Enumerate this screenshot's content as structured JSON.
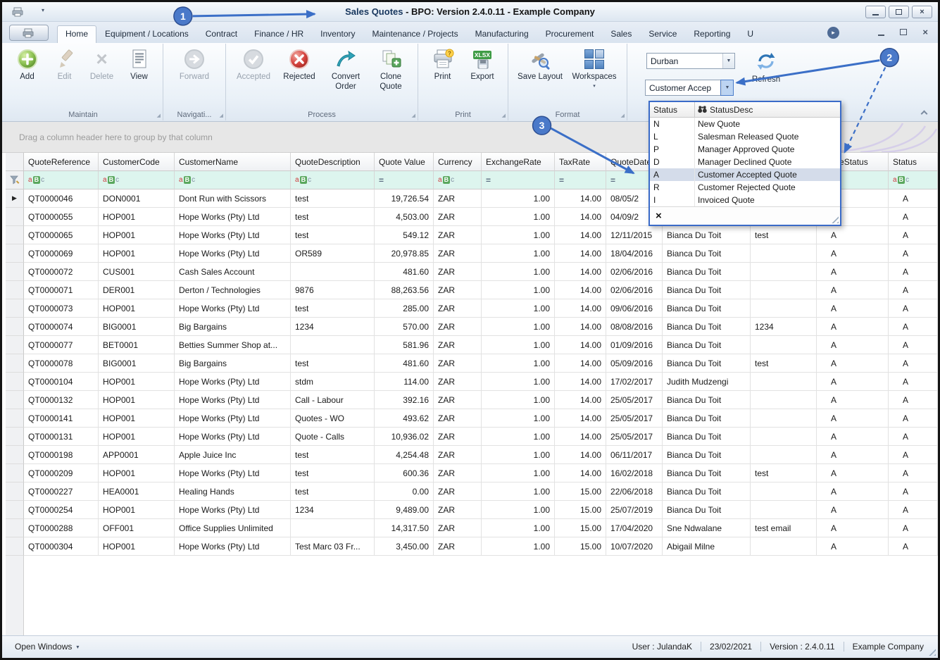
{
  "colors": {
    "accent_blue": "#3b6fc7",
    "selection_bg": "#d4dcea",
    "filter_row_bg": "#ddf5ee"
  },
  "titlebar": {
    "app_name": "Sales Quotes",
    "title_rest": " - BPO: Version 2.4.0.11 - Example Company"
  },
  "tabs": [
    {
      "label": "Home",
      "selected": true
    },
    {
      "label": "Equipment / Locations"
    },
    {
      "label": "Contract"
    },
    {
      "label": "Finance / HR"
    },
    {
      "label": "Inventory"
    },
    {
      "label": "Maintenance / Projects"
    },
    {
      "label": "Manufacturing"
    },
    {
      "label": "Procurement"
    },
    {
      "label": "Sales"
    },
    {
      "label": "Service"
    },
    {
      "label": "Reporting"
    },
    {
      "label": "U"
    }
  ],
  "ribbon": {
    "groups": [
      {
        "label": "Maintain",
        "buttons": [
          {
            "label": "Add",
            "icon": "add-icon"
          },
          {
            "label": "Edit",
            "icon": "edit-icon",
            "disabled": true
          },
          {
            "label": "Delete",
            "icon": "delete-icon",
            "disabled": true
          },
          {
            "label": "View",
            "icon": "view-icon"
          }
        ]
      },
      {
        "label": "Navigati...",
        "buttons": [
          {
            "label": "Forward",
            "icon": "forward-icon",
            "disabled": true
          }
        ]
      },
      {
        "label": "Process",
        "buttons": [
          {
            "label": "Accepted",
            "icon": "accepted-icon",
            "disabled": true
          },
          {
            "label": "Rejected",
            "icon": "rejected-icon"
          },
          {
            "label": "Convert Order",
            "icon": "convert-order-icon"
          },
          {
            "label": "Clone Quote",
            "icon": "clone-quote-icon"
          }
        ]
      },
      {
        "label": "Print",
        "buttons": [
          {
            "label": "Print",
            "icon": "print-icon"
          },
          {
            "label": "Export",
            "icon": "export-icon"
          }
        ]
      },
      {
        "label": "Format",
        "buttons": [
          {
            "label": "Save Layout",
            "icon": "save-layout-icon"
          },
          {
            "label": "Workspaces",
            "icon": "workspaces-icon",
            "dropdown": true
          }
        ]
      }
    ],
    "site_selector_value": "Durban",
    "status_filter_value": "Customer Accep",
    "refresh_label": "Refresh"
  },
  "grid": {
    "groupby_hint": "Drag a column header here to group by that column",
    "columns": [
      {
        "label": "QuoteReference",
        "filter": "abc"
      },
      {
        "label": "CustomerCode",
        "filter": "abc"
      },
      {
        "label": "CustomerName",
        "filter": "abc"
      },
      {
        "label": "QuoteDescription",
        "filter": "abc"
      },
      {
        "label": "Quote Value",
        "filter": "eq",
        "align": "right"
      },
      {
        "label": "Currency",
        "filter": "abc"
      },
      {
        "label": "ExchangeRate",
        "filter": "eq",
        "align": "right"
      },
      {
        "label": "TaxRate",
        "filter": "eq",
        "align": "right"
      },
      {
        "label": "QuoteDate",
        "filter": "eq"
      },
      {
        "label": "",
        "filter": ""
      },
      {
        "label": "",
        "filter": ""
      },
      {
        "label": "QuoteStatus",
        "filter": "abc"
      },
      {
        "label": "Status",
        "filter": "abc"
      }
    ],
    "rows": [
      [
        "QT0000046",
        "DON0001",
        "Dont Run with Scissors",
        "test",
        "19,726.54",
        "ZAR",
        "1.00",
        "14.00",
        "08/05/2",
        "",
        "",
        "",
        "A"
      ],
      [
        "QT0000055",
        "HOP001",
        "Hope Works (Pty) Ltd",
        "test",
        "4,503.00",
        "ZAR",
        "1.00",
        "14.00",
        "04/09/2",
        "",
        "",
        "",
        "A"
      ],
      [
        "QT0000065",
        "HOP001",
        "Hope Works (Pty) Ltd",
        "test",
        "549.12",
        "ZAR",
        "1.00",
        "14.00",
        "12/11/2015",
        "Bianca Du Toit",
        "test",
        "A",
        "A"
      ],
      [
        "QT0000069",
        "HOP001",
        "Hope Works (Pty) Ltd",
        "OR589",
        "20,978.85",
        "ZAR",
        "1.00",
        "14.00",
        "18/04/2016",
        "Bianca Du Toit",
        "",
        "A",
        "A"
      ],
      [
        "QT0000072",
        "CUS001",
        "Cash Sales Account",
        "",
        "481.60",
        "ZAR",
        "1.00",
        "14.00",
        "02/06/2016",
        "Bianca Du Toit",
        "",
        "A",
        "A"
      ],
      [
        "QT0000071",
        "DER001",
        "Derton / Technologies",
        "9876",
        "88,263.56",
        "ZAR",
        "1.00",
        "14.00",
        "02/06/2016",
        "Bianca Du Toit",
        "",
        "A",
        "A"
      ],
      [
        "QT0000073",
        "HOP001",
        "Hope Works (Pty) Ltd",
        "test",
        "285.00",
        "ZAR",
        "1.00",
        "14.00",
        "09/06/2016",
        "Bianca Du Toit",
        "",
        "A",
        "A"
      ],
      [
        "QT0000074",
        "BIG0001",
        "Big Bargains",
        "1234",
        "570.00",
        "ZAR",
        "1.00",
        "14.00",
        "08/08/2016",
        "Bianca Du Toit",
        "1234",
        "A",
        "A"
      ],
      [
        "QT0000077",
        "BET0001",
        "Betties Summer Shop at...",
        "",
        "581.96",
        "ZAR",
        "1.00",
        "14.00",
        "01/09/2016",
        "Bianca Du Toit",
        "",
        "A",
        "A"
      ],
      [
        "QT0000078",
        "BIG0001",
        "Big Bargains",
        "test",
        "481.60",
        "ZAR",
        "1.00",
        "14.00",
        "05/09/2016",
        "Bianca Du Toit",
        "test",
        "A",
        "A"
      ],
      [
        "QT0000104",
        "HOP001",
        "Hope Works (Pty) Ltd",
        "stdm",
        "114.00",
        "ZAR",
        "1.00",
        "14.00",
        "17/02/2017",
        "Judith Mudzengi",
        "",
        "A",
        "A"
      ],
      [
        "QT0000132",
        "HOP001",
        "Hope Works (Pty) Ltd",
        "Call - Labour",
        "392.16",
        "ZAR",
        "1.00",
        "14.00",
        "25/05/2017",
        "Bianca Du Toit",
        "",
        "A",
        "A"
      ],
      [
        "QT0000141",
        "HOP001",
        "Hope Works (Pty) Ltd",
        "Quotes - WO",
        "493.62",
        "ZAR",
        "1.00",
        "14.00",
        "25/05/2017",
        "Bianca Du Toit",
        "",
        "A",
        "A"
      ],
      [
        "QT0000131",
        "HOP001",
        "Hope Works (Pty) Ltd",
        "Quote - Calls",
        "10,936.02",
        "ZAR",
        "1.00",
        "14.00",
        "25/05/2017",
        "Bianca Du Toit",
        "",
        "A",
        "A"
      ],
      [
        "QT0000198",
        "APP0001",
        "Apple Juice Inc",
        "test",
        "4,254.48",
        "ZAR",
        "1.00",
        "14.00",
        "06/11/2017",
        "Bianca Du Toit",
        "",
        "A",
        "A"
      ],
      [
        "QT0000209",
        "HOP001",
        "Hope Works (Pty) Ltd",
        "test",
        "600.36",
        "ZAR",
        "1.00",
        "14.00",
        "16/02/2018",
        "Bianca Du Toit",
        "test",
        "A",
        "A"
      ],
      [
        "QT0000227",
        "HEA0001",
        "Healing Hands",
        "test",
        "0.00",
        "ZAR",
        "1.00",
        "15.00",
        "22/06/2018",
        "Bianca Du Toit",
        "",
        "A",
        "A"
      ],
      [
        "QT0000254",
        "HOP001",
        "Hope Works (Pty) Ltd",
        "1234",
        "9,489.00",
        "ZAR",
        "1.00",
        "15.00",
        "25/07/2019",
        "Bianca Du Toit",
        "",
        "A",
        "A"
      ],
      [
        "QT0000288",
        "OFF001",
        "Office Supplies Unlimited",
        "",
        "14,317.50",
        "ZAR",
        "1.00",
        "15.00",
        "17/04/2020",
        "Sne Ndwalane",
        "test email",
        "A",
        "A"
      ],
      [
        "QT0000304",
        "HOP001",
        "Hope Works (Pty) Ltd",
        "Test Marc 03 Fr...",
        "3,450.00",
        "ZAR",
        "1.00",
        "15.00",
        "10/07/2020",
        "Abigail Milne",
        "",
        "A",
        "A"
      ]
    ]
  },
  "status_popup": {
    "col_status": "Status",
    "col_desc": "StatusDesc",
    "options": [
      {
        "code": "N",
        "desc": "New Quote"
      },
      {
        "code": "L",
        "desc": "Salesman Released Quote"
      },
      {
        "code": "P",
        "desc": "Manager Approved Quote"
      },
      {
        "code": "D",
        "desc": "Manager Declined Quote"
      },
      {
        "code": "A",
        "desc": "Customer Accepted Quote",
        "selected": true
      },
      {
        "code": "R",
        "desc": "Customer Rejected Quote"
      },
      {
        "code": "I",
        "desc": "Invoiced Quote"
      }
    ]
  },
  "statusbar": {
    "open_windows": "Open Windows",
    "user": "User : JulandaK",
    "date": "23/02/2021",
    "version": "Version : 2.4.0.11",
    "company": "Example Company"
  },
  "annotations": {
    "steps": [
      "1",
      "2",
      "3"
    ]
  }
}
